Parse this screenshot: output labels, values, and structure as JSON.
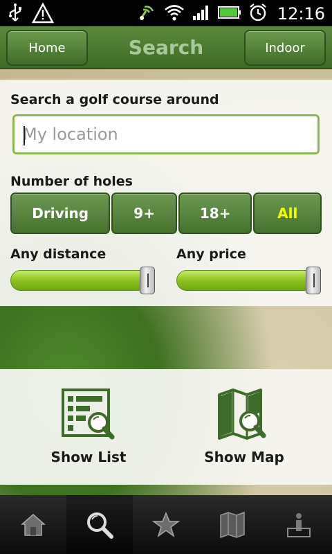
{
  "status_bar": {
    "time": "12:16",
    "icons": [
      "usb-icon",
      "warning-icon",
      "signal-broadcast-icon",
      "wifi-icon",
      "cell-signal-icon",
      "battery-icon",
      "alarm-icon"
    ]
  },
  "title_bar": {
    "title": "Search",
    "home_label": "Home",
    "indoor_label": "Indoor"
  },
  "search": {
    "label": "Search a golf course around",
    "placeholder": "My location",
    "value": ""
  },
  "holes": {
    "label": "Number of holes",
    "options": [
      "Driving",
      "9+",
      "18+",
      "All"
    ],
    "selected": "All",
    "selected_color": "#f6ff00"
  },
  "filters": {
    "distance_label": "Any distance",
    "distance_value": 1.0,
    "price_label": "Any price",
    "price_value": 1.0
  },
  "actions": {
    "list_label": "Show List",
    "map_label": "Show Map"
  },
  "tabs": [
    {
      "icon": "home-icon",
      "active": false
    },
    {
      "icon": "search-icon",
      "active": true
    },
    {
      "icon": "star-icon",
      "active": false
    },
    {
      "icon": "map-icon",
      "active": false
    },
    {
      "icon": "info-icon",
      "active": false
    }
  ],
  "colors": {
    "accent_green": "#4a7a30",
    "title_text": "#a9c99a",
    "slider_green": "#8cc21e"
  }
}
